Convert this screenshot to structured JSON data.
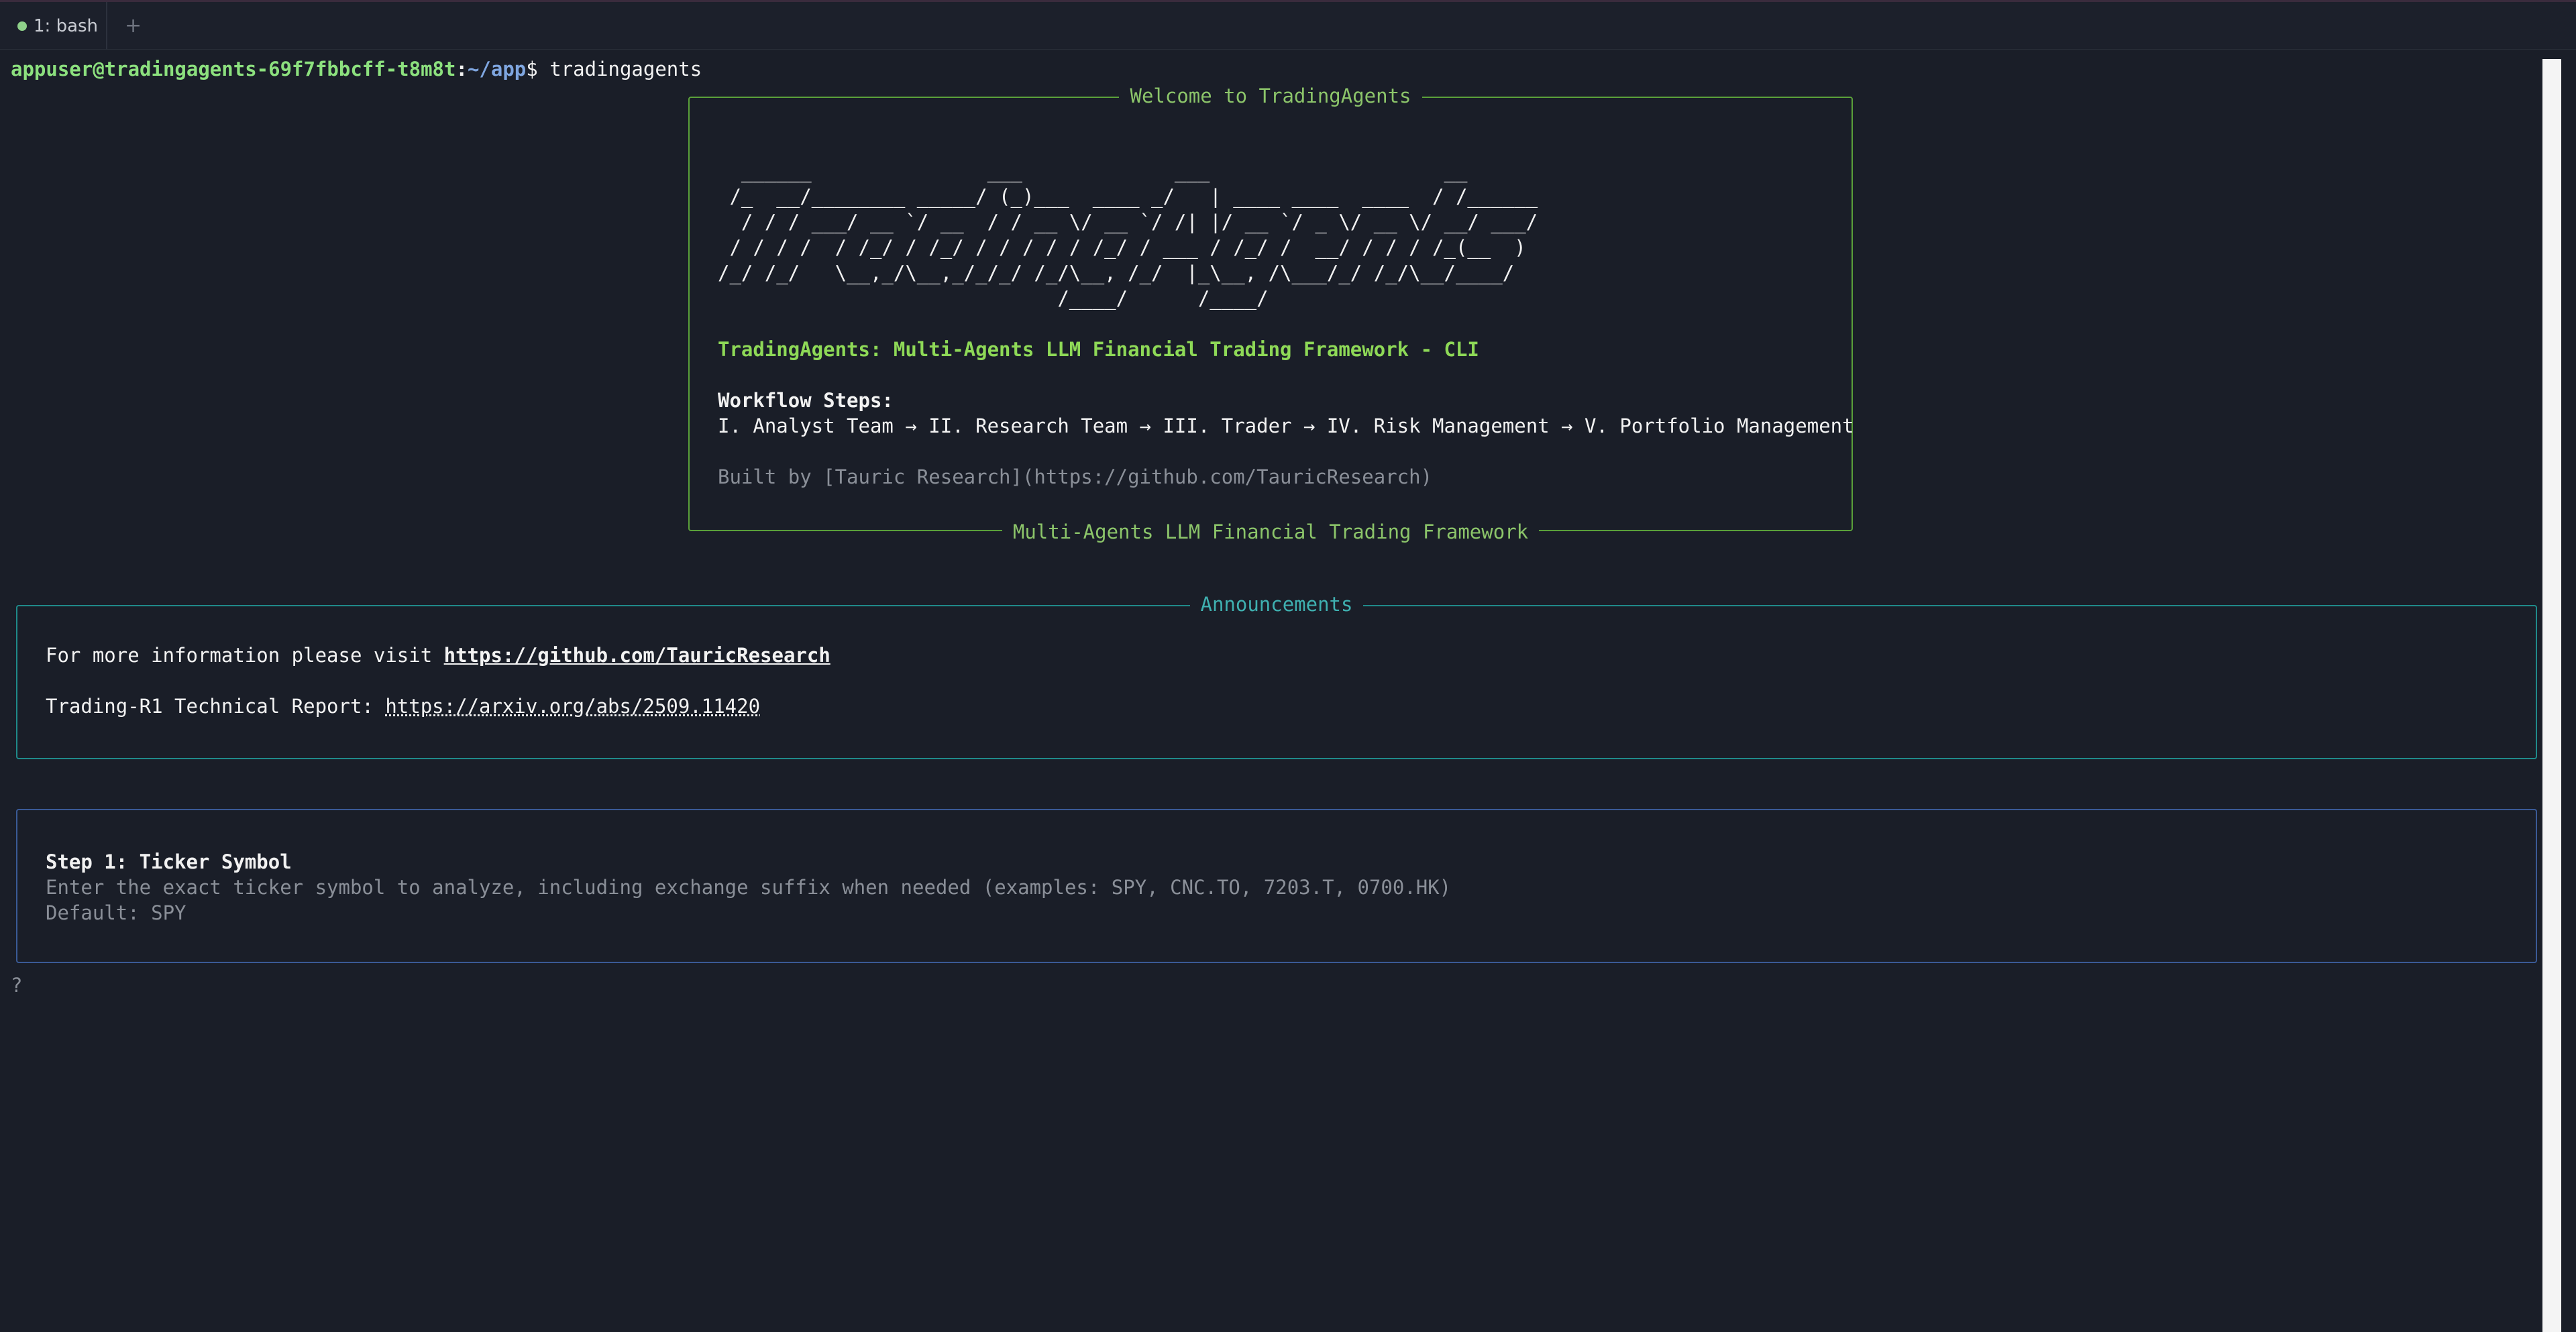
{
  "tabbar": {
    "tab_label": "1: bash",
    "add_label": "+"
  },
  "shell": {
    "user_host": "appuser@tradingagents-69f7fbbcff-t8m8t",
    "separator": ":",
    "path": "~/app",
    "dollar": "$",
    "command": "tradingagents"
  },
  "welcome": {
    "title": "Welcome to TradingAgents",
    "ascii_art": [
      "  ______               ___             ___                    __",
      " /_  __/________ _____/ (_)___  ____ _/   | ____ ____  ____  / /______",
      "  / / / ___/ __ `/ __  / / __ \\/ __ `/ /| |/ __ `/ _ \\/ __ \\/ __/ ___/",
      " / / / /  / /_/ / /_/ / / / / / /_/ / ___ / /_/ /  __/ / / / /_(__  )",
      "/_/ /_/   \\__,_/\\__,_/_/_/ /_/\\__, /_/  |_\\__, /\\___/_/ /_/\\__/____/",
      "                             /____/      /____/"
    ],
    "subtitle": "TradingAgents: Multi-Agents LLM Financial Trading Framework - CLI",
    "workflow_heading": "Workflow Steps:",
    "workflow_steps": "I. Analyst Team → II. Research Team → III. Trader → IV. Risk Management → V. Portfolio Management",
    "built_by": "Built by [Tauric Research](https://github.com/TauricResearch)",
    "footer": "Multi-Agents LLM Financial Trading Framework"
  },
  "announcements": {
    "title": "Announcements",
    "info_prefix": "For more information please visit ",
    "info_link": "https://github.com/TauricResearch",
    "report_prefix": "Trading-R1 Technical Report: ",
    "report_link": "https://arxiv.org/abs/2509.11420"
  },
  "step": {
    "heading": "Step 1: Ticker Symbol",
    "description": "Enter the exact ticker symbol to analyze, including exchange suffix when needed (examples: SPY, CNC.TO, 7203.T, 0700.HK)",
    "default": "Default: SPY"
  },
  "input_prompt": "?",
  "colors": {
    "background": "#1a1e28",
    "welcome_border": "#5aa03a",
    "announcements_border": "#1f8a8a",
    "step_border": "#3a5a96",
    "accent_green": "#8ed957"
  }
}
